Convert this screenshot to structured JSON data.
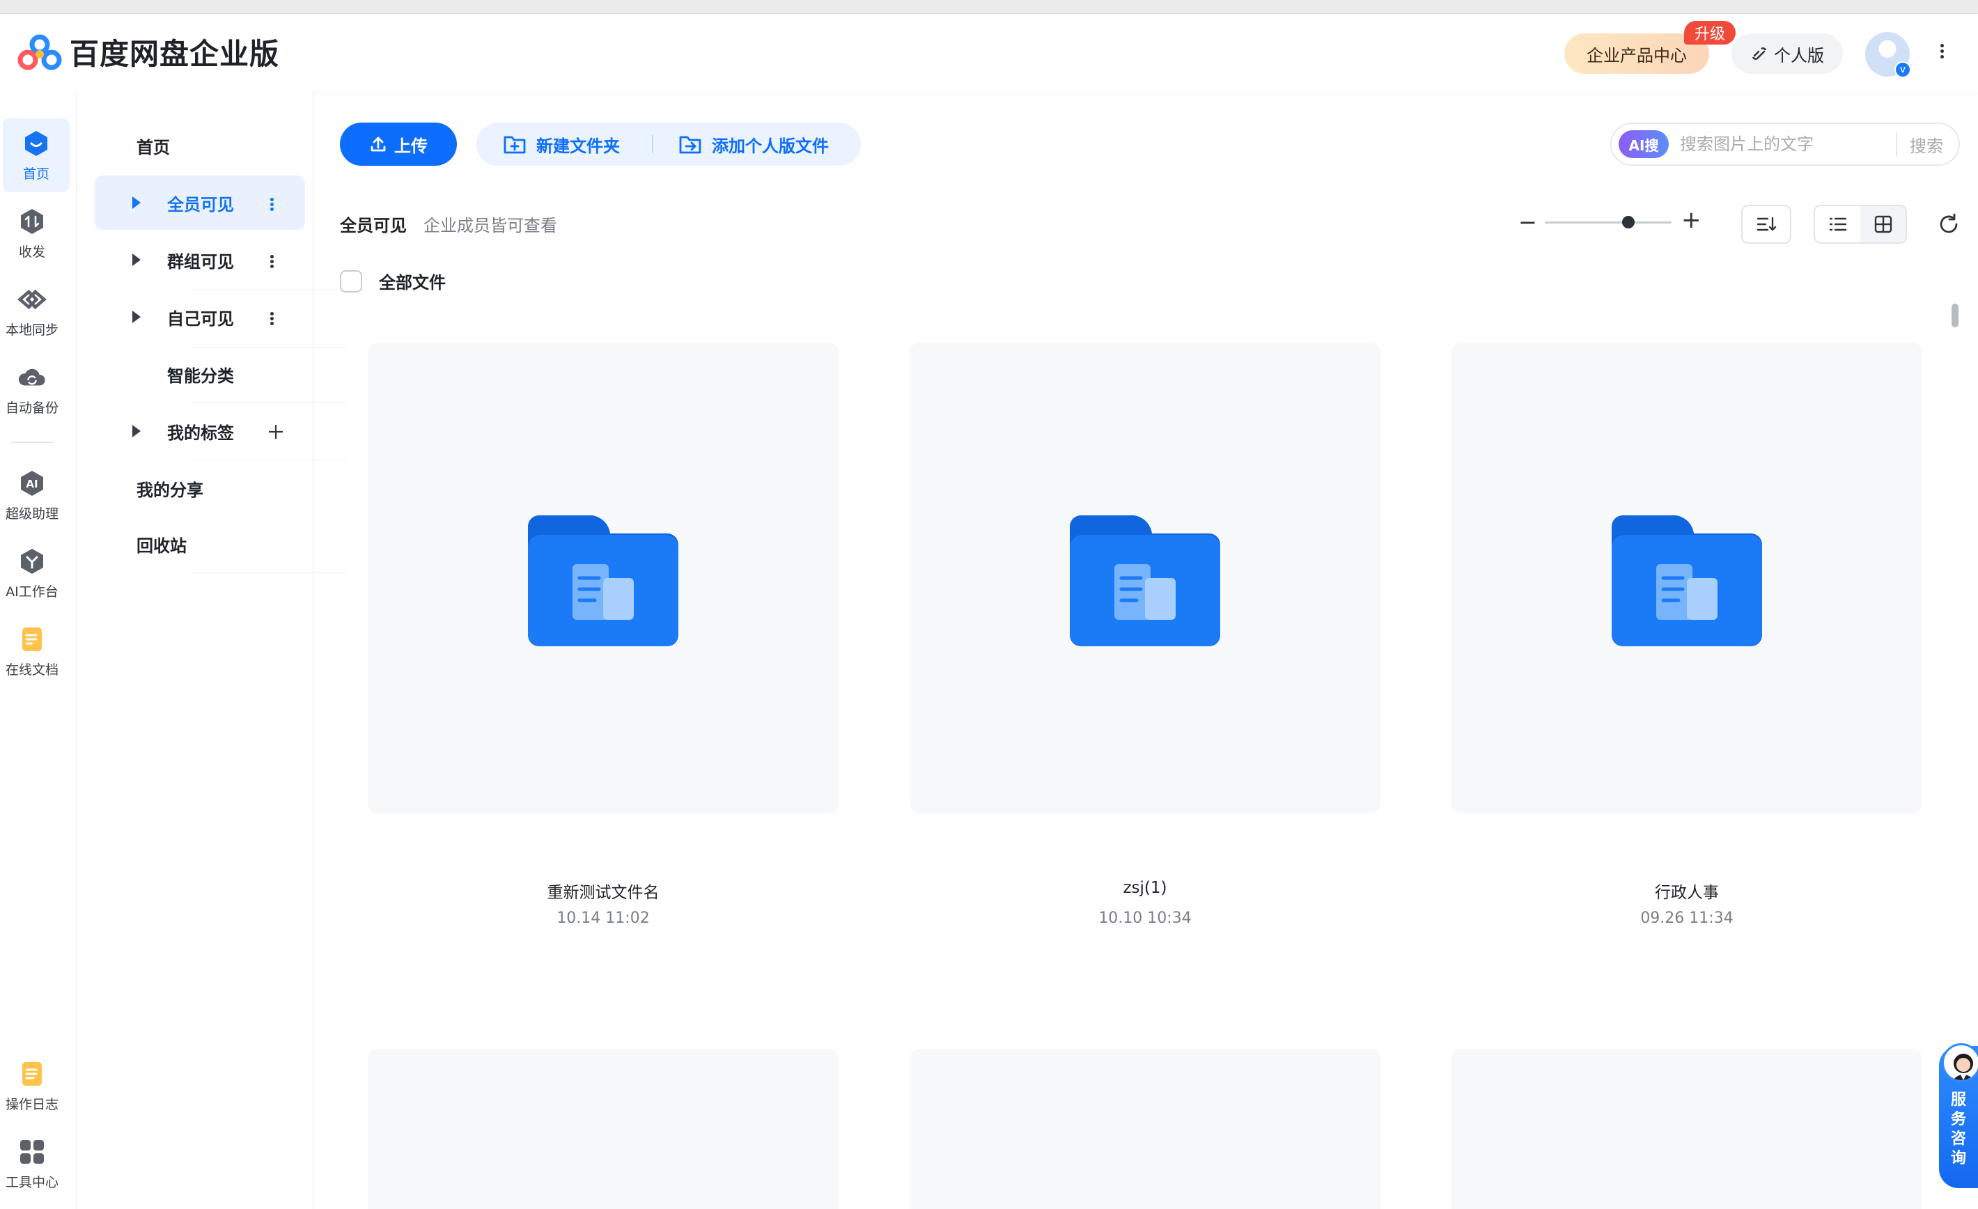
{
  "app": {
    "name": "百度网盘企业版",
    "enterprise_center": "企业产品中心",
    "upgrade_badge": "升级",
    "personal_edition": "个人版",
    "avatar_badge": "v"
  },
  "rail": [
    {
      "label": "首页",
      "icon": "home-icon",
      "active": true
    },
    {
      "label": "收发",
      "icon": "transfer-icon"
    },
    {
      "label": "本地同步",
      "icon": "sync-icon"
    },
    {
      "label": "自动备份",
      "icon": "cloud-backup-icon"
    },
    {
      "label": "超级助理",
      "icon": "ai-assistant-icon"
    },
    {
      "label": "AI工作台",
      "icon": "ai-workbench-icon"
    },
    {
      "label": "在线文档",
      "icon": "online-doc-icon"
    },
    {
      "label": "操作日志",
      "icon": "log-icon"
    },
    {
      "label": "工具中心",
      "icon": "tools-icon"
    }
  ],
  "tree": {
    "home": "首页",
    "items": [
      {
        "label": "全员可见",
        "selected": true
      },
      {
        "label": "群组可见"
      },
      {
        "label": "自己可见"
      },
      {
        "label": "智能分类"
      },
      {
        "label": "我的标签"
      }
    ],
    "my_share": "我的分享",
    "recycle_bin": "回收站"
  },
  "toolbar": {
    "upload": "上传",
    "new_folder": "新建文件夹",
    "add_personal": "添加个人版文件"
  },
  "search": {
    "ai_badge": "AI搜",
    "placeholder": "搜索图片上的文字",
    "button": "搜索"
  },
  "breadcrumb": {
    "title": "全员可见",
    "subtitle": "企业成员皆可查看"
  },
  "list": {
    "select_all": "全部文件",
    "zoom_level": 0.66,
    "folders": [
      {
        "name": "重新测试文件名",
        "date": "10.14 11:02"
      },
      {
        "name": "zsj(1)",
        "date": "10.10 10:34"
      },
      {
        "name": "行政人事",
        "date": "09.26 11:34"
      }
    ]
  },
  "service": {
    "label": "服\n务\n咨\n询"
  },
  "colors": {
    "primary": "#0d6efd",
    "folder": "#1b7af5",
    "upgrade": "#f04b3a"
  }
}
